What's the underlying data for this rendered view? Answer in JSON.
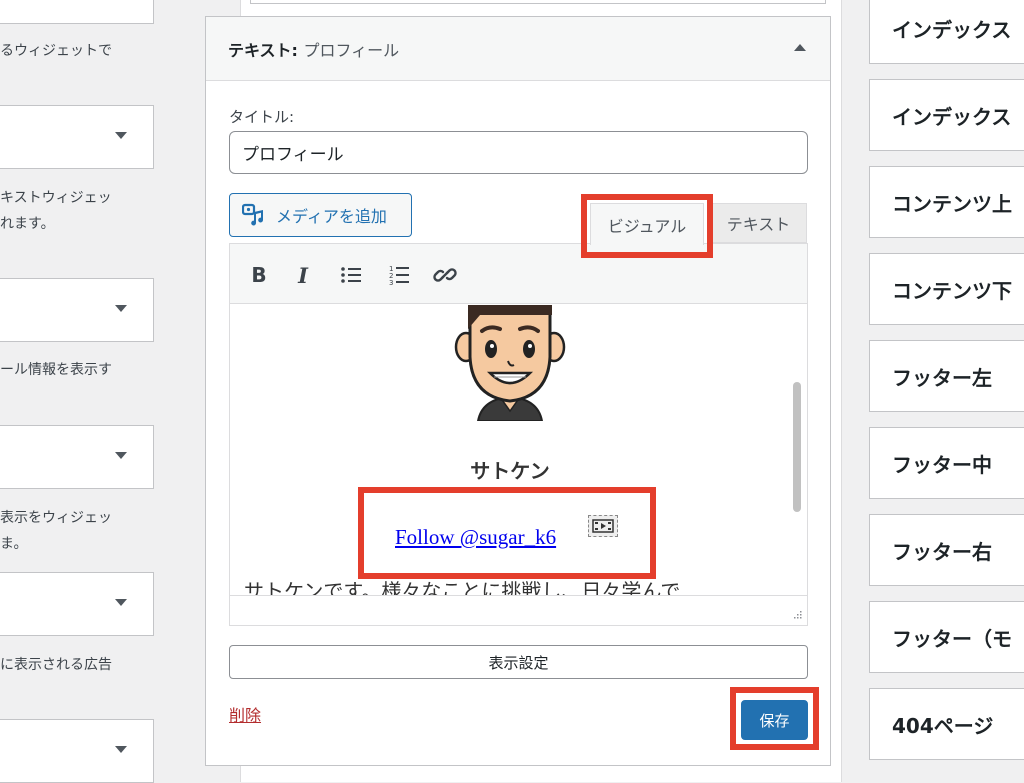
{
  "left_panel": {
    "descriptions": [
      "るウィジェットで",
      "キストウィジェッ\nれます。",
      "ール情報を表示す",
      "表示をウィジェッ\nま。",
      "に表示される広告"
    ]
  },
  "widget": {
    "title_prefix": "テキスト:",
    "title_name": "プロフィール",
    "title_label": "タイトル:",
    "title_value": "プロフィール",
    "add_media_label": "メディアを追加",
    "tab_visual": "ビジュアル",
    "tab_text": "テキスト",
    "content": {
      "name": "サトケン",
      "follow_link": "Follow @sugar_k6",
      "body_start": "サトケンです。様々なことに挑戦し、日々学んで"
    },
    "display_settings_label": "表示設定",
    "delete_label": "削除",
    "save_label": "保存"
  },
  "toolbar": {
    "bold_icon": "B",
    "italic_icon": "I"
  },
  "right_panel": {
    "areas": [
      "インデックス",
      "インデックス",
      "コンテンツ上",
      "コンテンツ下",
      "フッター左",
      "フッター中",
      "フッター右",
      "フッター（モ",
      "404ページ"
    ]
  },
  "colors": {
    "highlight": "#e43e2c",
    "primary": "#2271b1",
    "delete": "#b32d2e"
  }
}
